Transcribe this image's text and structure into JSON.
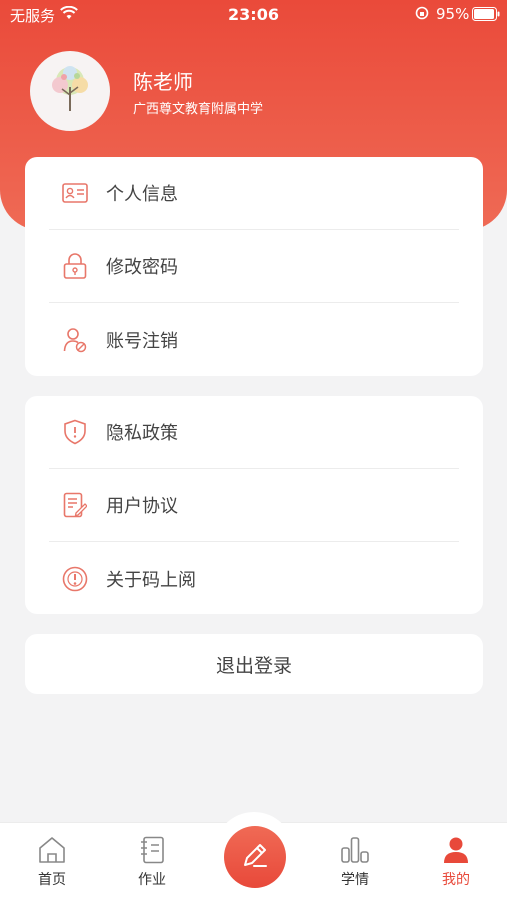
{
  "status_bar": {
    "carrier": "无服务",
    "time": "23:06",
    "battery": "95%"
  },
  "profile": {
    "name": "陈老师",
    "school": "广西尊文教育附属中学",
    "avatar_icon": "tree-avatar-icon"
  },
  "account_menu": [
    {
      "label": "个人信息",
      "icon": "id-card-icon"
    },
    {
      "label": "修改密码",
      "icon": "lock-icon"
    },
    {
      "label": "账号注销",
      "icon": "user-cancel-icon"
    }
  ],
  "about_menu": [
    {
      "label": "隐私政策",
      "icon": "shield-icon"
    },
    {
      "label": "用户协议",
      "icon": "document-edit-icon"
    },
    {
      "label": "关于码上阅",
      "icon": "info-icon"
    }
  ],
  "logout": {
    "label": "退出登录"
  },
  "tabbar": {
    "home": "首页",
    "homework": "作业",
    "study": "学情",
    "me": "我的",
    "active": "me"
  },
  "colors": {
    "accent": "#e8493a",
    "icon": "#e8776a"
  }
}
